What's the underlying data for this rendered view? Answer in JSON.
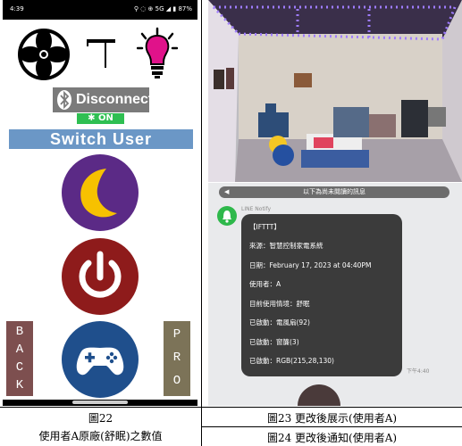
{
  "phone": {
    "status_time": "4:39",
    "status_icons": "⚲ ◌ ⊕ 5G ◢ ▮ 87%",
    "bt_disconnect_label": "Disconnect",
    "bt_state": "ON",
    "switch_user_label": "Switch User",
    "back_label": "BACK",
    "pro_label": "PRO"
  },
  "captions": {
    "fig22_title": "圖22",
    "fig22_desc": "使用者A原廠(舒眠)之數值",
    "fig23": "圖23 更改後展示(使用者A)",
    "fig24": "圖24 更改後通知(使用者A)"
  },
  "chat": {
    "banner": "以下為尚未閱讀的訊息",
    "sender": "LINE Notify",
    "lines": [
      "【IFTTT】",
      "來源：智慧控制家電系統",
      "日期：February 17, 2023 at 04:40PM",
      "使用者：A",
      "目前使用情境：舒眠",
      "已啟動：電風扇(92)",
      "已啟動：窗簾(3)",
      "已啟動：RGB(215,28,130)"
    ],
    "time": "下午4:40"
  },
  "colors": {
    "moon_bg": "#5b2a86",
    "moon": "#f7c100",
    "power_bg": "#8e1b1b",
    "game_bg": "#1f4f8c",
    "bulb": "#e0128a",
    "bt_on": "#2fbf52",
    "switch_bg": "#6b97c6",
    "back_bg": "#7d4f4f",
    "pro_bg": "#7c7358"
  }
}
